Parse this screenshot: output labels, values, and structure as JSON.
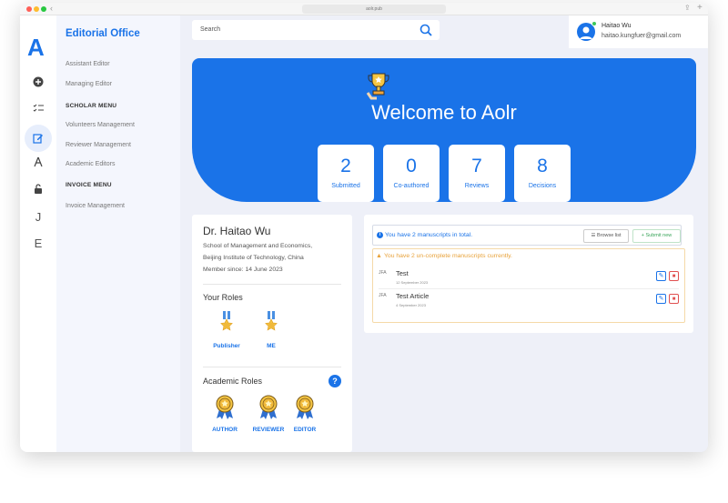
{
  "browser": {
    "url": "aolr.pub"
  },
  "brand": {
    "logo_letter": "A"
  },
  "rail": {
    "icons": [
      "plus-circle-icon",
      "tasks-icon",
      "edit-icon",
      "compass-icon",
      "lock-icon",
      "J",
      "E"
    ]
  },
  "sidebar": {
    "title": "Editorial Office",
    "items_top": [
      "Assistant Editor",
      "Managing Editor"
    ],
    "scholar_heading": "SCHOLAR MENU",
    "scholar_items": [
      "Volunteers Management",
      "Reviewer Management",
      "Academic Editors"
    ],
    "invoice_heading": "INVOICE MENU",
    "invoice_items": [
      "Invoice Management"
    ]
  },
  "search": {
    "placeholder": "Search"
  },
  "user": {
    "name": "Haitao Wu",
    "email": "haitao.kungfuer@gmail.com"
  },
  "banner": {
    "welcome": "Welcome to Aolr",
    "stats": [
      {
        "value": "2",
        "label": "Submitted"
      },
      {
        "value": "0",
        "label": "Co-authored"
      },
      {
        "value": "7",
        "label": "Reviews"
      },
      {
        "value": "8",
        "label": "Decisions"
      }
    ]
  },
  "profile": {
    "name": "Dr. Haitao Wu",
    "affiliation_line1": "School of Management and Economics,",
    "affiliation_line2": "Beijing Institute of Technology, China",
    "member_since": "Member since: 14 June 2023",
    "your_roles_title": "Your Roles",
    "your_roles": [
      "Publisher",
      "ME"
    ],
    "academic_roles_title": "Academic Roles",
    "academic_roles": [
      "AUTHOR",
      "REVIEWER",
      "EDITOR"
    ],
    "help_label": "?"
  },
  "manuscripts": {
    "info_text": "You have 2 manuscripts in total.",
    "browse_label": "Browse list",
    "submit_label": "Submit new",
    "warning_text": "You have 2 un-complete manuscripts currently.",
    "items": [
      {
        "journal": "JFA",
        "title": "Test",
        "date": "12 September 2023"
      },
      {
        "journal": "JFA",
        "title": "Test Article",
        "date": "4 September 2023"
      }
    ]
  },
  "colors": {
    "accent": "#1a73e8",
    "warning": "#e8a23a",
    "danger": "#e05050",
    "online": "#3cc75a"
  }
}
